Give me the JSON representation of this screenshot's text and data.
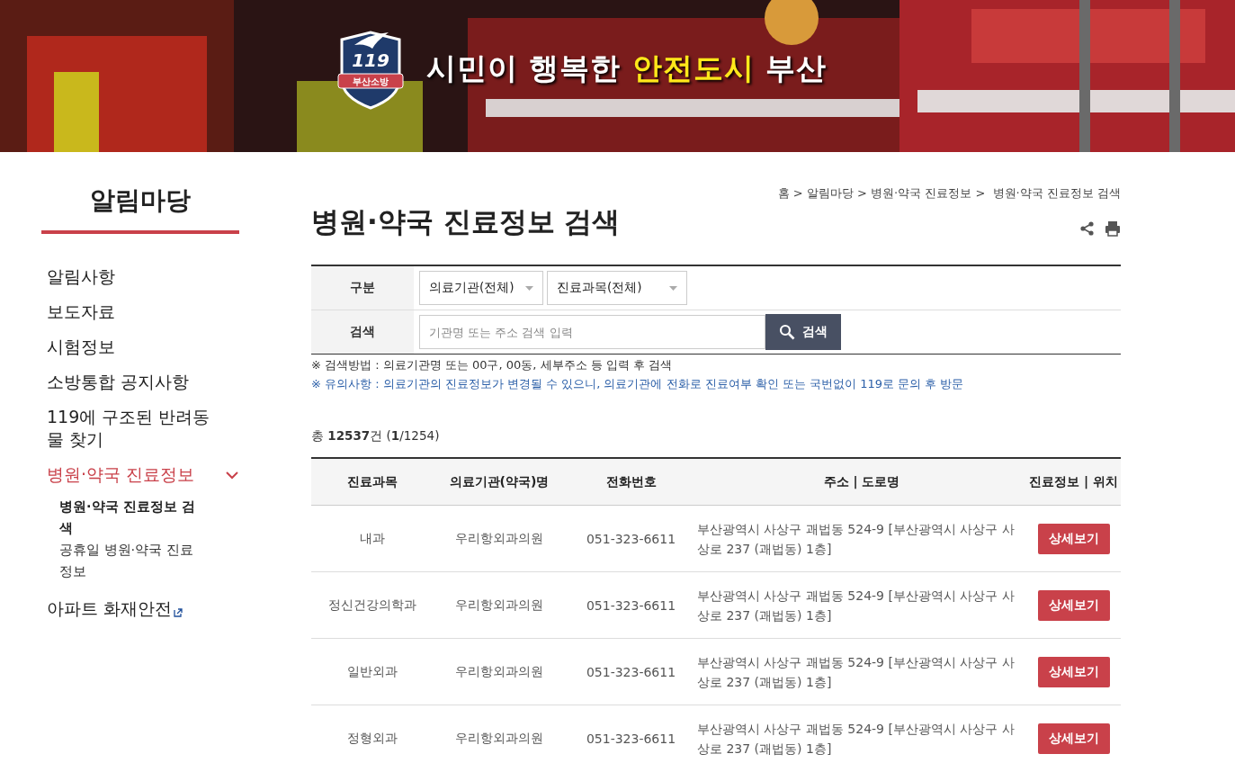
{
  "banner": {
    "logo": {
      "number": "119",
      "name": "부산소방"
    },
    "slogan": [
      {
        "text": "시민이 행복한 ",
        "highlight": false
      },
      {
        "text": "안전도시",
        "highlight": true
      },
      {
        "text": " 부산",
        "highlight": false
      }
    ]
  },
  "sidebar": {
    "title": "알림마당",
    "items": [
      {
        "label": "알림사항",
        "selected": false,
        "expanded": false,
        "external": false
      },
      {
        "label": "보도자료",
        "selected": false,
        "expanded": false,
        "external": false
      },
      {
        "label": "시험정보",
        "selected": false,
        "expanded": false,
        "external": false
      },
      {
        "label": "소방통합 공지사항",
        "selected": false,
        "expanded": false,
        "external": false
      },
      {
        "label": "119에 구조된 반려동물 찾기",
        "selected": false,
        "expanded": false,
        "external": false
      },
      {
        "label": "병원·약국 진료정보",
        "selected": true,
        "expanded": true,
        "external": false,
        "children": [
          {
            "label": "병원·약국 진료정보 검색",
            "selected": true
          },
          {
            "label": "공휴일 병원·약국 진료정보",
            "selected": false
          }
        ]
      },
      {
        "label": "아파트 화재안전",
        "selected": false,
        "expanded": false,
        "external": true
      }
    ]
  },
  "breadcrumb": "홈 > 알림마당 > 병원·약국 진료정보 >  병원·약국 진료정보 검색",
  "page_title": "병원·약국 진료정보 검색",
  "search_form": {
    "category_label": "구분",
    "selects": [
      {
        "value": "의료기관(전체)"
      },
      {
        "value": "진료과목(전체)"
      }
    ],
    "search_label": "검색",
    "placeholder": "기관명 또는 주소 검색 입력",
    "button": "검색"
  },
  "notes": [
    {
      "text": "※ 검색방법 : 의료기관명 또는 00구, 00동, 세부주소 등 입력 후 검색",
      "kind": "plain"
    },
    {
      "text": "※ 유의사항 : 의료기관의 진료정보가 변경될 수 있으니, 의료기관에 전화로 진료여부 확인 또는 국번없이 119로 문의 후 방문",
      "kind": "warning"
    }
  ],
  "summary": "총 **12537**건 (**1**/1254)",
  "table": {
    "columns": [
      "진료과목",
      "의료기관(약국)명",
      "전화번호",
      "주소 | 도로명",
      "진료정보 | 위치"
    ],
    "rows": [
      {
        "cells": [
          "내과",
          "우리항외과의원",
          "051-323-6611",
          "부산광역시 사상구 괘법동 524-9 [부산광역시 사상구 사상로 237 (괘법동) 1층]"
        ],
        "button": "상세보기"
      },
      {
        "cells": [
          "정신건강의학과",
          "우리항외과의원",
          "051-323-6611",
          "부산광역시 사상구 괘법동 524-9 [부산광역시 사상구 사상로 237 (괘법동) 1층]"
        ],
        "button": "상세보기"
      },
      {
        "cells": [
          "일반외과",
          "우리항외과의원",
          "051-323-6611",
          "부산광역시 사상구 괘법동 524-9 [부산광역시 사상구 사상로 237 (괘법동) 1층]"
        ],
        "button": "상세보기"
      },
      {
        "cells": [
          "정형외과",
          "우리항외과의원",
          "051-323-6611",
          "부산광역시 사상구 괘법동 524-9 [부산광역시 사상구 사상로 237 (괘법동) 1층]"
        ],
        "button": "상세보기"
      }
    ]
  }
}
